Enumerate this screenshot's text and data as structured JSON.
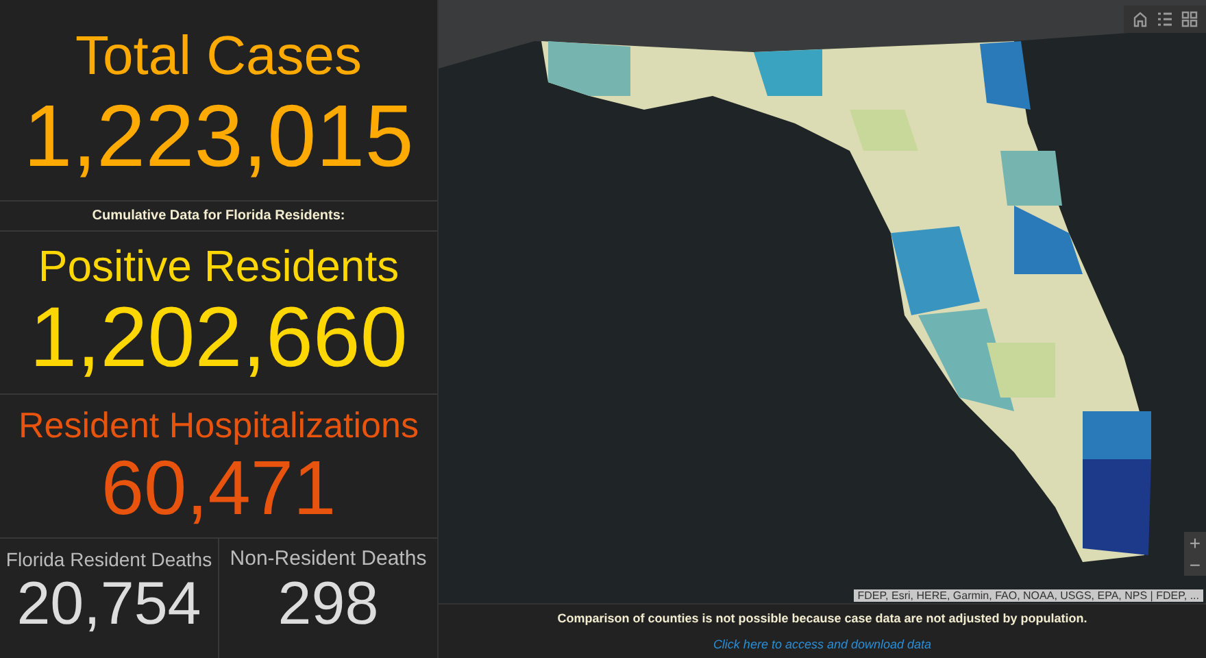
{
  "stats": [
    {
      "label": "Total Cases",
      "value": "1,223,015",
      "color": "#ffaa00"
    }
  ],
  "caption": "Cumulative Data for Florida Residents:",
  "resident_stats": [
    {
      "label": "Positive Residents",
      "value": "1,202,660",
      "color": "#ffd700"
    },
    {
      "label": "Resident Hospitalizations",
      "value": "60,471",
      "color": "#e8540e"
    }
  ],
  "deaths": [
    {
      "label": "Florida Resident Deaths",
      "value": "20,754"
    },
    {
      "label": "Non-Resident Deaths",
      "value": "298"
    }
  ],
  "map": {
    "attribution": "FDEP, Esri, HERE, Garmin, FAO, NOAA, USGS, EPA, NPS | FDEP, ...",
    "zoom_controls": [
      "+",
      "−"
    ]
  },
  "footer": {
    "note": "Comparison of counties is not possible because case data are not adjusted by population.",
    "link": "Click here to access and download data"
  }
}
